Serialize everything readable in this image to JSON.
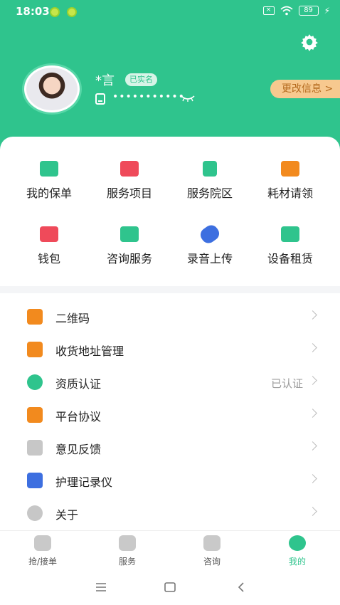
{
  "status": {
    "time": "18:03",
    "battery": "89"
  },
  "profile": {
    "name": "*言",
    "verified_badge": "已实名",
    "phone_masked": "•••••••••••",
    "edit_button": "更改信息 >"
  },
  "grid": [
    {
      "label": "我的保单",
      "icon": "policy-shield-icon",
      "color": "#2fc48d"
    },
    {
      "label": "服务项目",
      "icon": "folder-list-icon",
      "color": "#ef4a5a"
    },
    {
      "label": "服务院区",
      "icon": "building-icon",
      "color": "#2fc48d"
    },
    {
      "label": "耗材请领",
      "icon": "medical-kit-icon",
      "color": "#f28a1e"
    },
    {
      "label": "钱包",
      "icon": "wallet-icon",
      "color": "#ef4a5a"
    },
    {
      "label": "咨询服务",
      "icon": "chat-bubble-icon",
      "color": "#2fc48d"
    },
    {
      "label": "录音上传",
      "icon": "microphone-icon",
      "color": "#3d6fe0"
    },
    {
      "label": "设备租赁",
      "icon": "device-icon",
      "color": "#2fc48d"
    }
  ],
  "menu": [
    {
      "label": "二维码",
      "value": "",
      "icon": "qr-code-icon",
      "color": "#f28a1e"
    },
    {
      "label": "收货地址管理",
      "value": "",
      "icon": "address-book-icon",
      "color": "#f28a1e"
    },
    {
      "label": "资质认证",
      "value": "已认证",
      "icon": "certificate-badge-icon",
      "color": "#2fc48d"
    },
    {
      "label": "平台协议",
      "value": "",
      "icon": "agreement-doc-icon",
      "color": "#f28a1e"
    },
    {
      "label": "意见反馈",
      "value": "",
      "icon": "feedback-bubble-icon",
      "color": "#c7c7c7"
    },
    {
      "label": "护理记录仪",
      "value": "",
      "icon": "recorder-icon",
      "color": "#3d6fe0"
    },
    {
      "label": "关于",
      "value": "",
      "icon": "info-icon",
      "color": "#c7c7c7"
    }
  ],
  "tabs": [
    {
      "label": "抢/接单",
      "icon": "grab-order-icon"
    },
    {
      "label": "服务",
      "icon": "service-icon"
    },
    {
      "label": "咨询",
      "icon": "consult-icon"
    },
    {
      "label": "我的",
      "icon": "mine-icon",
      "active": true
    }
  ]
}
